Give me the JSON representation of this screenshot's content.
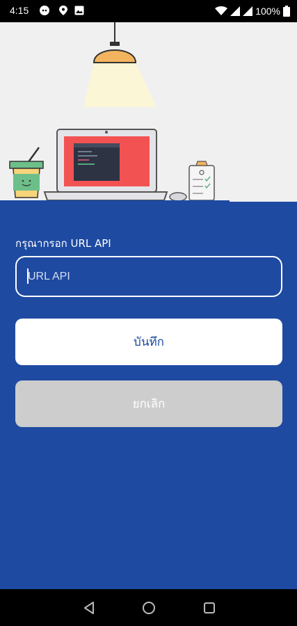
{
  "status_bar": {
    "time": "4:15",
    "battery": "100%",
    "icons": [
      "reddit-icon",
      "location-icon",
      "image-icon",
      "wifi-icon",
      "signal-icon",
      "battery-icon"
    ]
  },
  "form": {
    "label": "กรุณากรอก URL API",
    "input_placeholder": "URL API",
    "input_value": "",
    "save_label": "บันทึก",
    "cancel_label": "ยกเลิก"
  },
  "nav_bar": {
    "buttons": [
      "back-icon",
      "home-icon",
      "recents-icon"
    ]
  },
  "colors": {
    "panel": "#1e4aa1",
    "hero_bg": "#f0f0f0",
    "laptop_screen": "#f25252",
    "lamp": "#f4b45f",
    "cancel_bg": "#cdcdcd"
  }
}
